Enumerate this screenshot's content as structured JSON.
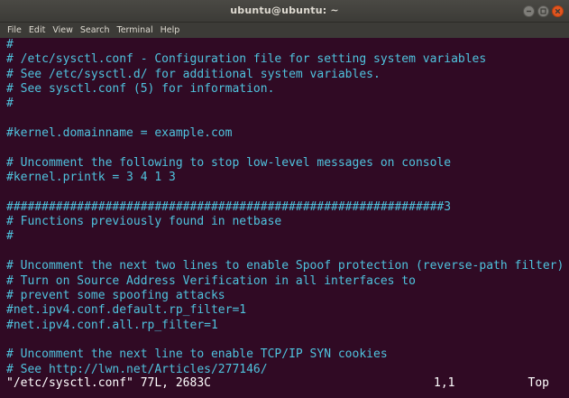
{
  "window": {
    "title": "ubuntu@ubuntu: ~"
  },
  "menu": [
    "File",
    "Edit",
    "View",
    "Search",
    "Terminal",
    "Help"
  ],
  "colors": {
    "background": "#300a24",
    "comment": "#4fc3de",
    "text": "#ffffff",
    "titlebar": "#3c3b37",
    "close_button": "#e2551f"
  },
  "lines": [
    "#",
    "# /etc/sysctl.conf - Configuration file for setting system variables",
    "# See /etc/sysctl.d/ for additional system variables.",
    "# See sysctl.conf (5) for information.",
    "#",
    "",
    "#kernel.domainname = example.com",
    "",
    "# Uncomment the following to stop low-level messages on console",
    "#kernel.printk = 3 4 1 3",
    "",
    "##############################################################3",
    "# Functions previously found in netbase",
    "#",
    "",
    "# Uncomment the next two lines to enable Spoof protection (reverse-path filter)",
    "# Turn on Source Address Verification in all interfaces to",
    "# prevent some spoofing attacks",
    "#net.ipv4.conf.default.rp_filter=1",
    "#net.ipv4.conf.all.rp_filter=1",
    "",
    "# Uncomment the next line to enable TCP/IP SYN cookies",
    "# See http://lwn.net/Articles/277146/"
  ],
  "status": {
    "file_info": "\"/etc/sysctl.conf\" 77L, 2683C",
    "cursor_pos": "1,1",
    "scroll": "Top"
  }
}
